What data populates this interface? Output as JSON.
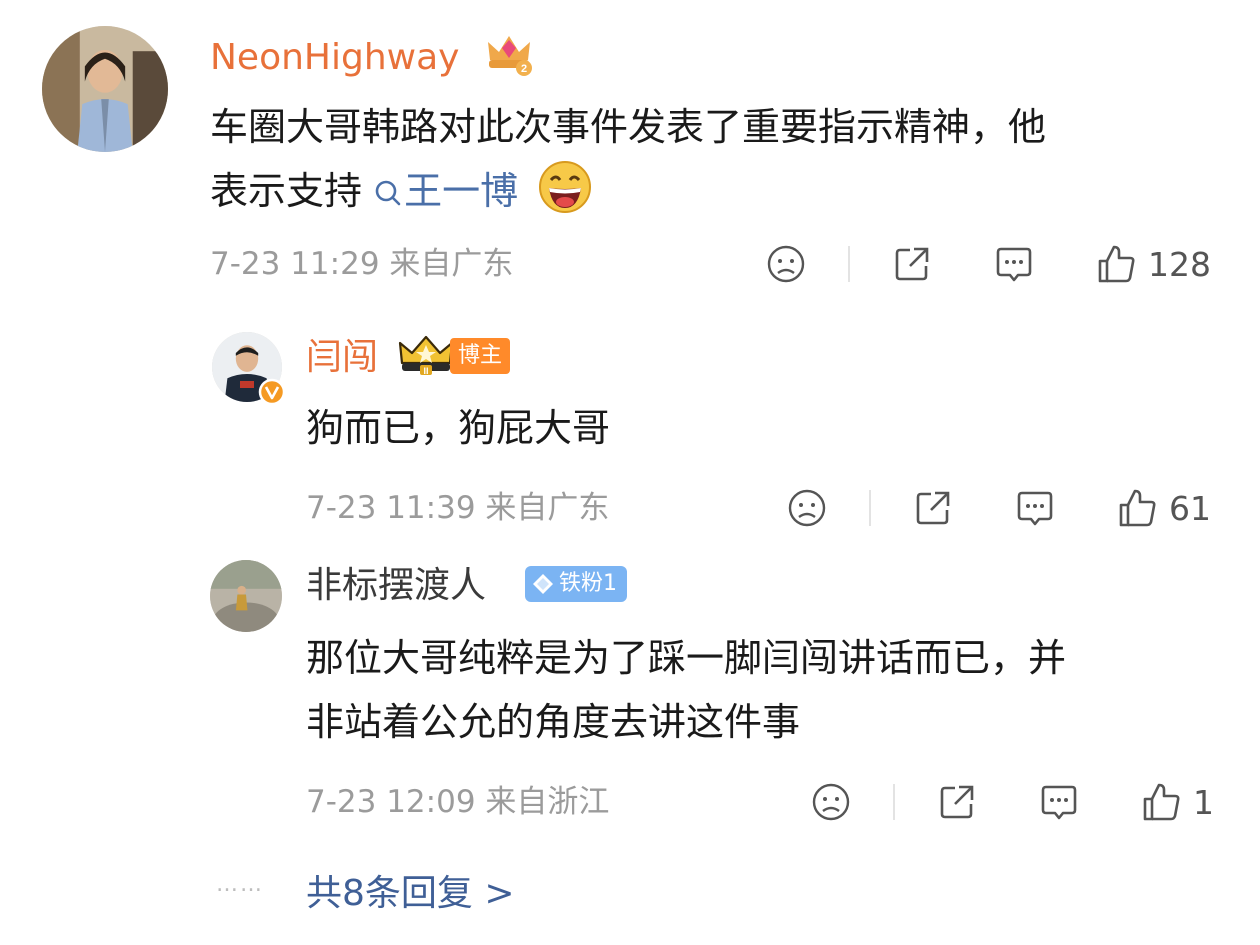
{
  "comments": [
    {
      "username": "NeonHighway",
      "content_line1": "车圈大哥韩路对此次事件发表了重要指示精神，他",
      "content_prefix": "表示支持",
      "topic": "王一博",
      "time": "7-23 11:29",
      "location": "来自广东",
      "likes": "128"
    },
    {
      "username": "闫闯",
      "badge": "博主",
      "content": "狗而已，狗屁大哥",
      "time": "7-23 11:39",
      "location": "来自广东",
      "likes": "61"
    },
    {
      "username": "非标摆渡人",
      "badge": "铁粉1",
      "content_line1": "那位大哥纯粹是为了踩一脚闫闯讲话而已，并",
      "content_line2": "非站着公允的角度去讲这件事",
      "time": "7-23 12:09",
      "location": "来自浙江",
      "likes": "1"
    }
  ],
  "footer": {
    "dots": "……",
    "more_replies": "共8条回复 >"
  },
  "colors": {
    "username_orange": "#e8713a",
    "topic_blue": "#4a6fa8",
    "meta_gray": "#9b9b9b",
    "link_blue": "#3f5f96"
  },
  "icons": [
    "crown-vip-icon",
    "verified-icon",
    "crown-level-icon",
    "diamond-icon",
    "laugh-emoji-icon",
    "search-icon",
    "dislike-icon",
    "share-icon",
    "comment-icon",
    "like-icon"
  ]
}
